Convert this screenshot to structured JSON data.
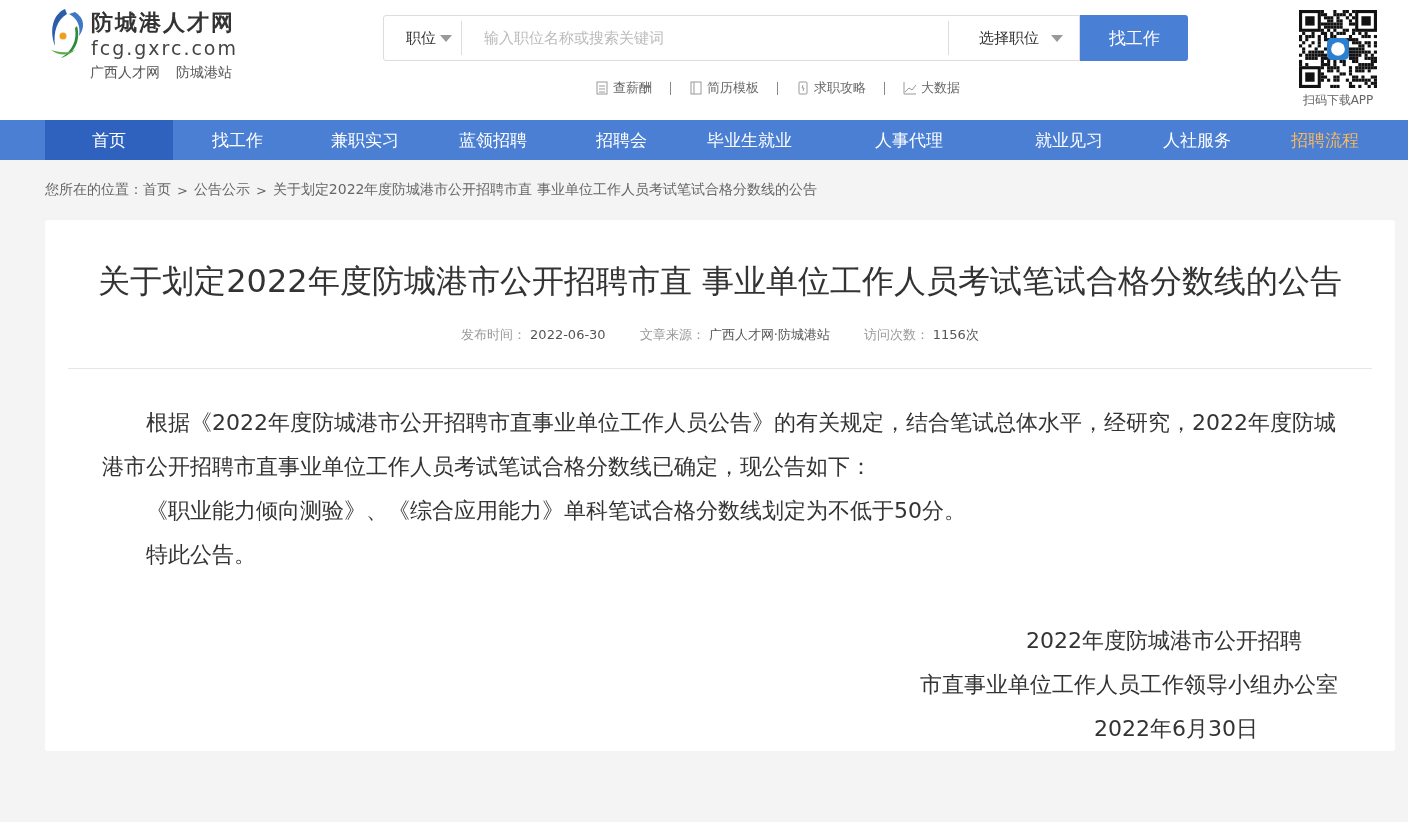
{
  "header": {
    "logo": {
      "name": "防城港人才网",
      "domain": "fcg.gxrc.com",
      "links": [
        "广西人才网",
        "防城港站"
      ]
    },
    "search": {
      "category": "职位",
      "placeholder": "输入职位名称或搜索关键词",
      "select": "选择职位",
      "button": "找工作"
    },
    "quick_links": [
      {
        "label": "查薪酬",
        "kind": "salary"
      },
      {
        "label": "简历模板",
        "kind": "resume"
      },
      {
        "label": "求职攻略",
        "kind": "guide"
      },
      {
        "label": "大数据",
        "kind": "data"
      }
    ],
    "qr": {
      "caption": "扫码下载APP"
    }
  },
  "nav": [
    {
      "label": "首页",
      "selected": true,
      "highlighted": false
    },
    {
      "label": "找工作",
      "selected": false,
      "highlighted": false
    },
    {
      "label": "兼职实习",
      "selected": false,
      "highlighted": false
    },
    {
      "label": "蓝领招聘",
      "selected": false,
      "highlighted": false
    },
    {
      "label": "招聘会",
      "selected": false,
      "highlighted": false
    },
    {
      "label": "毕业生就业",
      "selected": false,
      "highlighted": false
    },
    {
      "label": "人事代理",
      "selected": false,
      "highlighted": false
    },
    {
      "label": "就业见习",
      "selected": false,
      "highlighted": false
    },
    {
      "label": "人社服务",
      "selected": false,
      "highlighted": false
    },
    {
      "label": "招聘流程",
      "selected": false,
      "highlighted": true
    }
  ],
  "breadcrumb": {
    "label": "您所在的位置：",
    "items": [
      {
        "label": "首页"
      },
      {
        "separator": ">",
        "label": "公告公示"
      },
      {
        "separator": ">",
        "label": "关于划定2022年度防城港市公开招聘市直 事业单位工作人员考试笔试合格分数线的公告"
      }
    ]
  },
  "article": {
    "title": "关于划定2022年度防城港市公开招聘市直 事业单位工作人员考试笔试合格分数线的公告",
    "meta": [
      {
        "label": "发布时间：",
        "value": "2022-06-30"
      },
      {
        "label": "文章来源：",
        "value": "广西人才网·防城港站"
      },
      {
        "label": "访问次数：",
        "value": "1156次"
      }
    ],
    "paragraphs": [
      "根据《2022年度防城港市公开招聘市直事业单位工作人员公告》的有关规定，结合笔试总体水平，经研究，2022年度防城港市公开招聘市直事业单位工作人员考试笔试合格分数线已确定，现公告如下：",
      "《职业能力倾向测验》、《综合应用能力》单科笔试合格分数线划定为不低于50分。",
      "特此公告。"
    ],
    "signature": [
      "2022年度防城港市公开招聘",
      "市直事业单位工作人员工作领导小组办公室",
      "2022年6月30日"
    ]
  }
}
